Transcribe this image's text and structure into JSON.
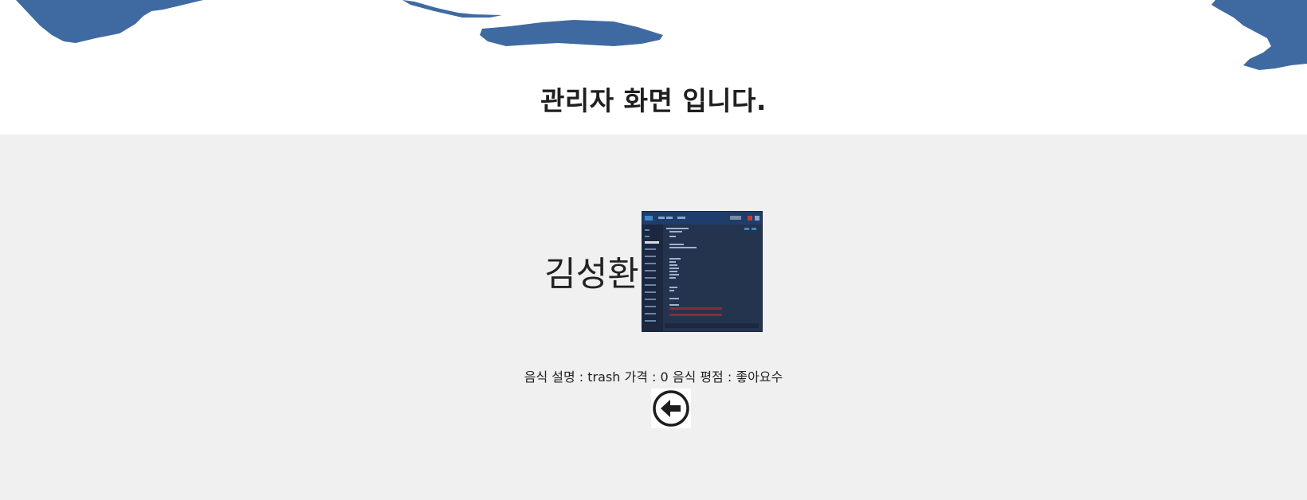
{
  "header": {
    "title": "관리자 화면 입니다."
  },
  "food": {
    "name": "김성환",
    "image_alt": "food-thumbnail",
    "description_label": "음식 설명 :",
    "description_value": "trash",
    "price_label": "가격 :",
    "price_value": "0",
    "rating_label": "음식 평점 :",
    "rating_value": "좋아요수"
  },
  "back_button": {
    "icon": "arrow-left-circle-icon"
  },
  "colors": {
    "header_bg": "#ffffff",
    "content_bg": "#f0f0f0",
    "map_blue": "#3f6aa1",
    "thumb_bg": "#24344f"
  }
}
